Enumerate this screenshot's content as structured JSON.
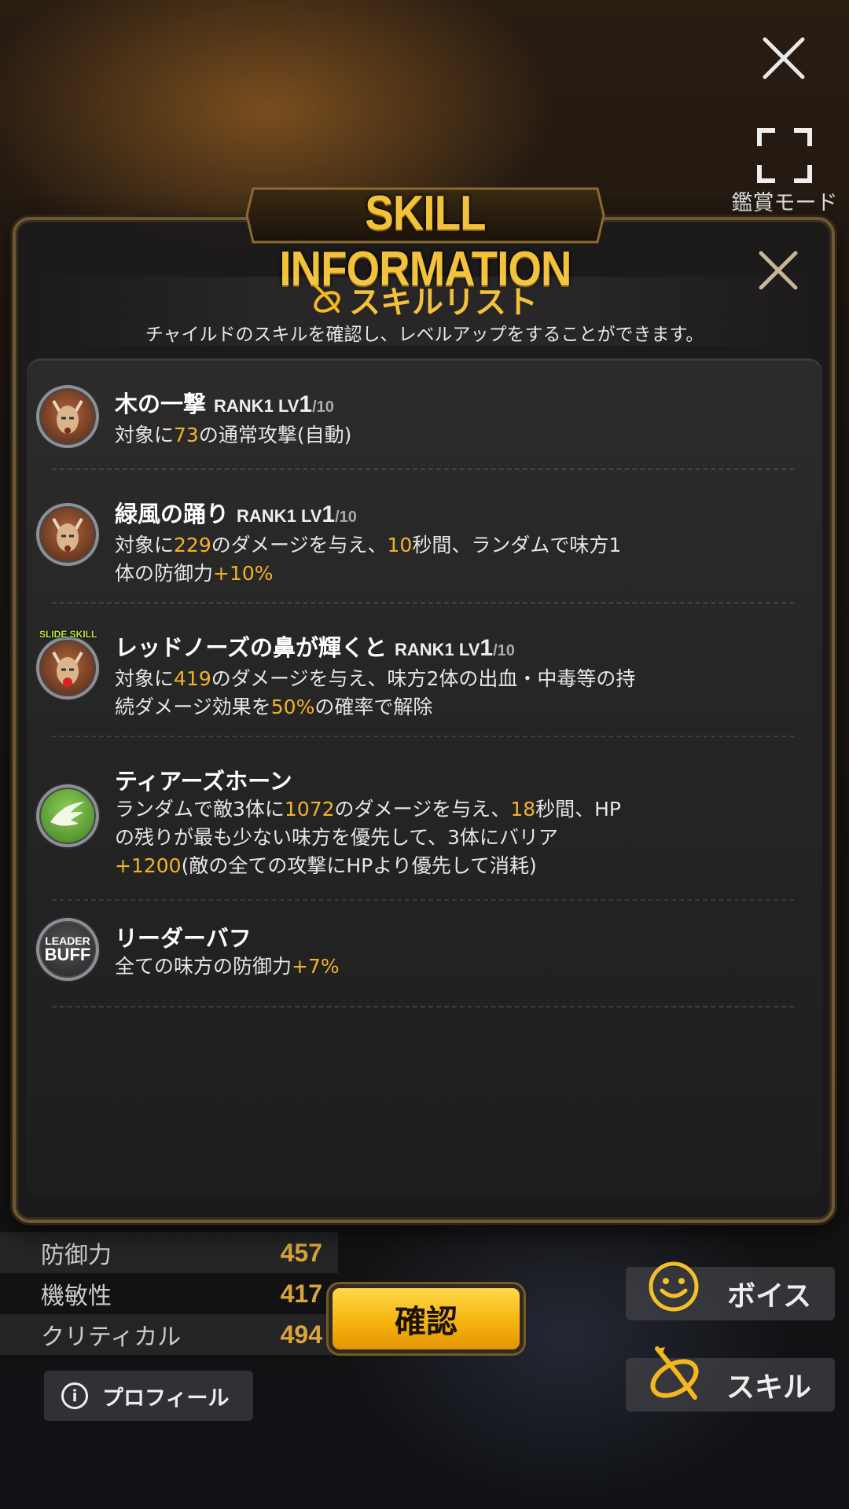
{
  "top": {
    "appreciation_mode_label": "鑑賞モード"
  },
  "background_profile": {
    "stats": [
      {
        "label": "防御力",
        "value": "457"
      },
      {
        "label": "機敏性",
        "value": "417"
      },
      {
        "label": "クリティカル",
        "value": "494"
      }
    ],
    "profile_button": "プロフィール",
    "voice_button": "ボイス",
    "skill_button": "スキル"
  },
  "modal": {
    "title": "SKILL INFORMATION",
    "heading": "スキルリスト",
    "subtitle": "チャイルドのスキルを確認し、レベルアップをすることができます。",
    "confirm_button": "確認",
    "skills": [
      {
        "name": "木の一撃",
        "rank": "RANK1",
        "lv": "LV",
        "lv_value": "1",
        "lv_max": "/10",
        "desc_parts": [
          "対象に",
          "73",
          "の通常攻撃(自動)"
        ],
        "line2": []
      },
      {
        "name": "緑風の踊り",
        "rank": "RANK1",
        "lv": "LV",
        "lv_value": "1",
        "lv_max": "/10",
        "desc_parts": [
          "対象に",
          "229",
          "のダメージを与え、",
          "10",
          "秒間、ランダムで味方1"
        ],
        "line2": [
          "体の防御力",
          "+10%"
        ]
      },
      {
        "name": "レッドノーズの鼻が輝くと",
        "badge": "SLIDE SKILL",
        "rank": "RANK1",
        "lv": "LV",
        "lv_value": "1",
        "lv_max": "/10",
        "desc_parts": [
          "対象に",
          "419",
          "のダメージを与え、味方2体の出血・中毒等の持"
        ],
        "line2": [
          "続ダメージ効果を",
          "50%",
          "の確率で解除"
        ]
      },
      {
        "name": "ティアーズホーン",
        "desc_parts": [
          "ランダムで敵3体に",
          "1072",
          "のダメージを与え、",
          "18",
          "秒間、HP"
        ],
        "line2": [
          "の残りが最も少ない味方を優先して、3体にバリア"
        ],
        "line3": [
          "+1200",
          "(敵の全ての攻撃にHPより優先して消耗)"
        ]
      },
      {
        "name": "リーダーバフ",
        "badge_top": "LEADER",
        "badge_bottom": "BUFF",
        "desc_parts": [
          "全ての味方の防御力",
          "+7%"
        ]
      }
    ]
  },
  "colors": {
    "accent": "#f4b327",
    "frame": "#6e5835",
    "confirm": "#f6b410"
  },
  "icons": [
    "close-icon",
    "fullscreen-icon",
    "skill-feather-icon",
    "smile-icon",
    "info-icon",
    "wing-icon",
    "deer-mask-icon"
  ]
}
